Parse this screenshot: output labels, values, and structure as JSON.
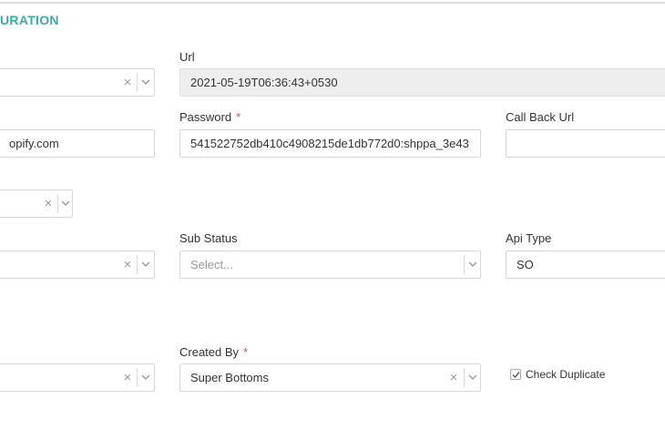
{
  "section": {
    "title": "URATION"
  },
  "row1": {
    "left_select": {
      "value": ""
    },
    "url": {
      "label": "Url",
      "value": "2021-05-19T06:36:43+0530"
    }
  },
  "row2": {
    "left_input": {
      "value": "opify.com"
    },
    "password": {
      "label": "Password",
      "required": "*",
      "value": "541522752db410c4908215de1db772d0:shppa_3e43"
    },
    "callback": {
      "label": "Call Back Url",
      "value": ""
    }
  },
  "row3": {
    "small_select": {
      "value": ""
    }
  },
  "row4": {
    "left_select": {
      "value": ""
    },
    "sub_status": {
      "label": "Sub Status",
      "placeholder": "Select..."
    },
    "api_type": {
      "label": "Api Type",
      "value": "SO"
    }
  },
  "row5": {
    "left_select": {
      "value": ""
    },
    "created_by": {
      "label": "Created By",
      "required": "*",
      "value": "Super Bottoms"
    },
    "check_duplicate": {
      "label": "Check Duplicate",
      "checked": true
    }
  },
  "glyphs": {
    "clear": "×"
  }
}
